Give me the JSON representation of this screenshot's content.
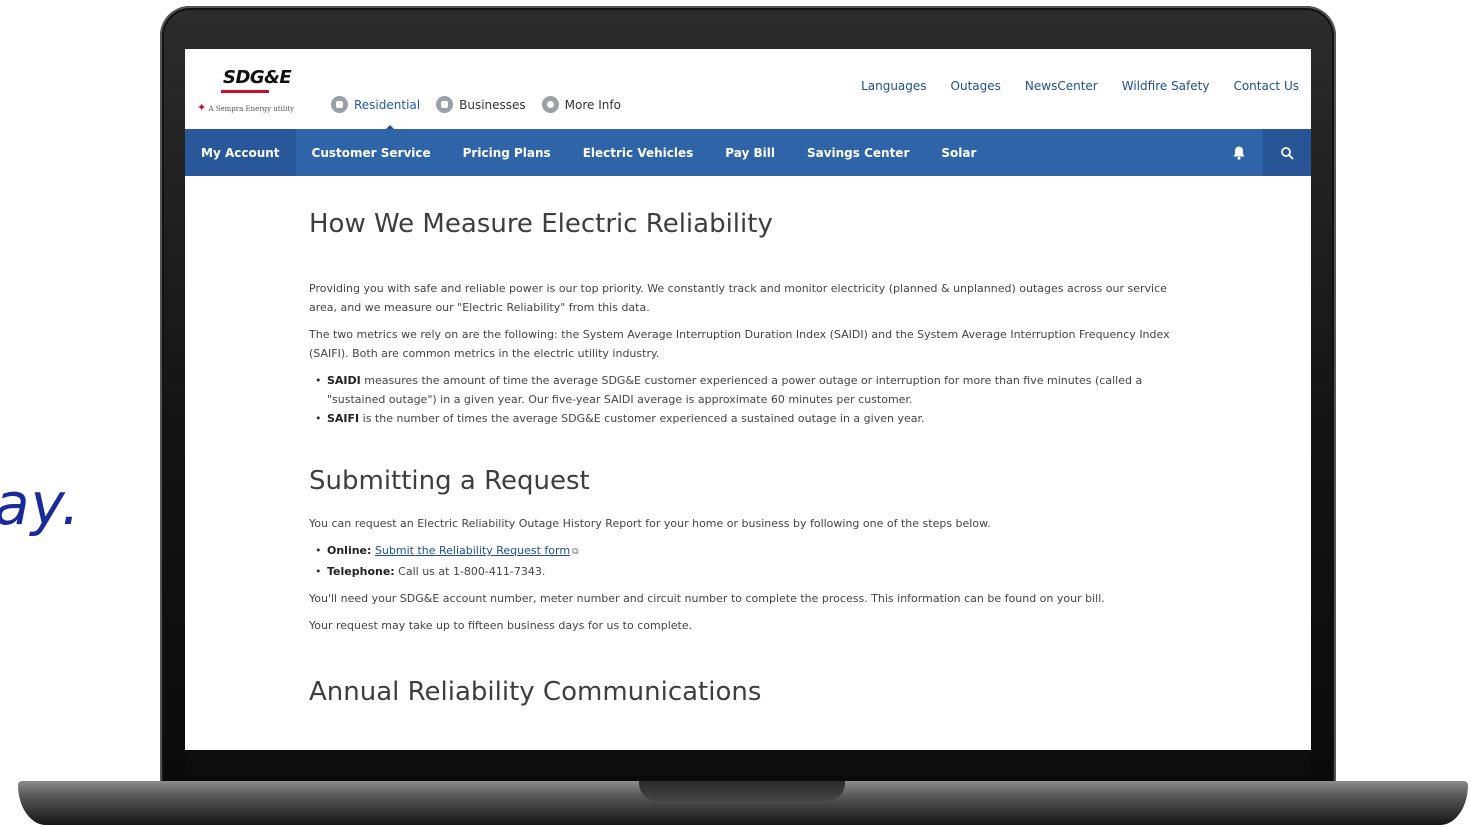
{
  "background": {
    "tagline_fragment": "ay."
  },
  "header": {
    "logo": {
      "word": "SDG&E",
      "sub": "A Sempra Energy utility"
    },
    "segments": [
      {
        "label": "Residential",
        "active": true
      },
      {
        "label": "Businesses",
        "active": false
      },
      {
        "label": "More Info",
        "active": false
      }
    ],
    "utility_links": [
      "Languages",
      "Outages",
      "NewsCenter",
      "Wildfire Safety",
      "Contact Us"
    ]
  },
  "nav": {
    "items": [
      "My Account",
      "Customer Service",
      "Pricing Plans",
      "Electric Vehicles",
      "Pay Bill",
      "Savings Center",
      "Solar"
    ],
    "bell_icon": "bell-icon",
    "search_icon": "search-icon"
  },
  "content": {
    "title": "How We Measure Electric Reliability",
    "p1": "Providing you with safe and reliable power is our top priority. We constantly track and monitor electricity (planned & unplanned) outages across our service area, and we measure our \"Electric Reliability\" from this data.",
    "p2": "The two metrics we rely on are the following: the System Average Interruption Duration Index (SAIDI) and the System Average Interruption Frequency Index (SAIFI). Both are common metrics in the electric utility industry.",
    "saidi_term": "SAIDI",
    "saidi_text": " measures the amount of time the average SDG&E customer experienced a power outage or interruption for more than five minutes (called a \"sustained outage\") in a given year. Our five-year SAIDI average is approximate 60 minutes per customer.",
    "saifi_term": "SAIFI",
    "saifi_text": " is the number of times the average SDG&E customer experienced a sustained outage in a given year.",
    "section2_title": "Submitting a Request",
    "p3": "You can request an Electric Reliability Outage History Report for your home or business by following one of the steps below.",
    "online_label": "Online:",
    "online_link": "Submit the Reliability Request form",
    "telephone_label": "Telephone:",
    "telephone_text": " Call us at 1-800-411-7343.",
    "p4": "You'll need your SDG&E account number, meter number and circuit number to complete the process. This information can be found on your bill.",
    "p5": "Your request may take up to fifteen business days for us to complete.",
    "section3_title": "Annual Reliability Communications"
  },
  "colors": {
    "nav_blue": "#2f65a8",
    "link_blue": "#1f4f8f",
    "logo_red": "#c8102e",
    "tagline_blue": "#1b2a9a"
  }
}
